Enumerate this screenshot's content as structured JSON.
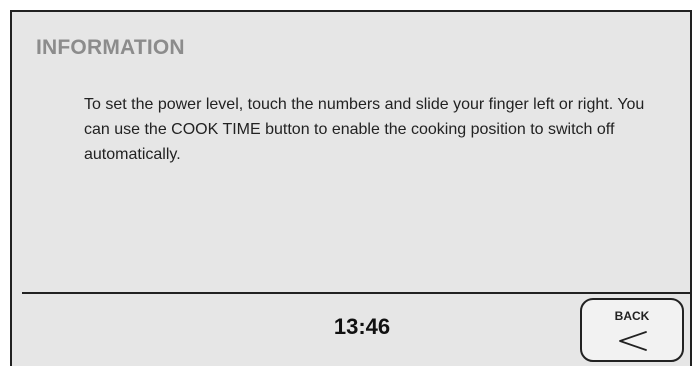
{
  "dialog": {
    "title": "INFORMATION",
    "message": "To set the power level, touch the numbers and slide your finger left or right. You can use the COOK TIME button to enable the cooking position to switch off automatically."
  },
  "footer": {
    "time": "13:46",
    "back_label": "BACK",
    "back_icon": "chevron-left-icon"
  },
  "colors": {
    "background": "#e6e6e6",
    "title": "#8c8c8c",
    "text": "#222222",
    "border": "#222222"
  }
}
